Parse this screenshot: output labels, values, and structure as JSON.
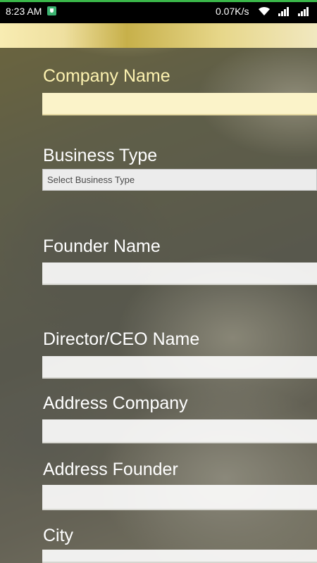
{
  "status_bar": {
    "time": "8:23 AM",
    "network_speed": "0.07K/s",
    "icons": [
      "shield-icon",
      "wifi-icon",
      "signal-icon",
      "signal-icon"
    ]
  },
  "form": {
    "company_name_label": "Company Name",
    "company_name_value": "",
    "business_type_label": "Business Type",
    "business_type_placeholder": "Select Business Type",
    "founder_name_label": "Founder Name",
    "founder_name_value": "",
    "director_label": "Director/CEO Name",
    "director_value": "",
    "address_company_label": "Address Company",
    "address_company_value": "",
    "address_founder_label": "Address Founder",
    "address_founder_value": "",
    "city_label": "City",
    "city_value": ""
  },
  "colors": {
    "status_accent": "#3bb84a",
    "label_text": "#ffffff",
    "first_label_text": "#fdf2b0"
  }
}
